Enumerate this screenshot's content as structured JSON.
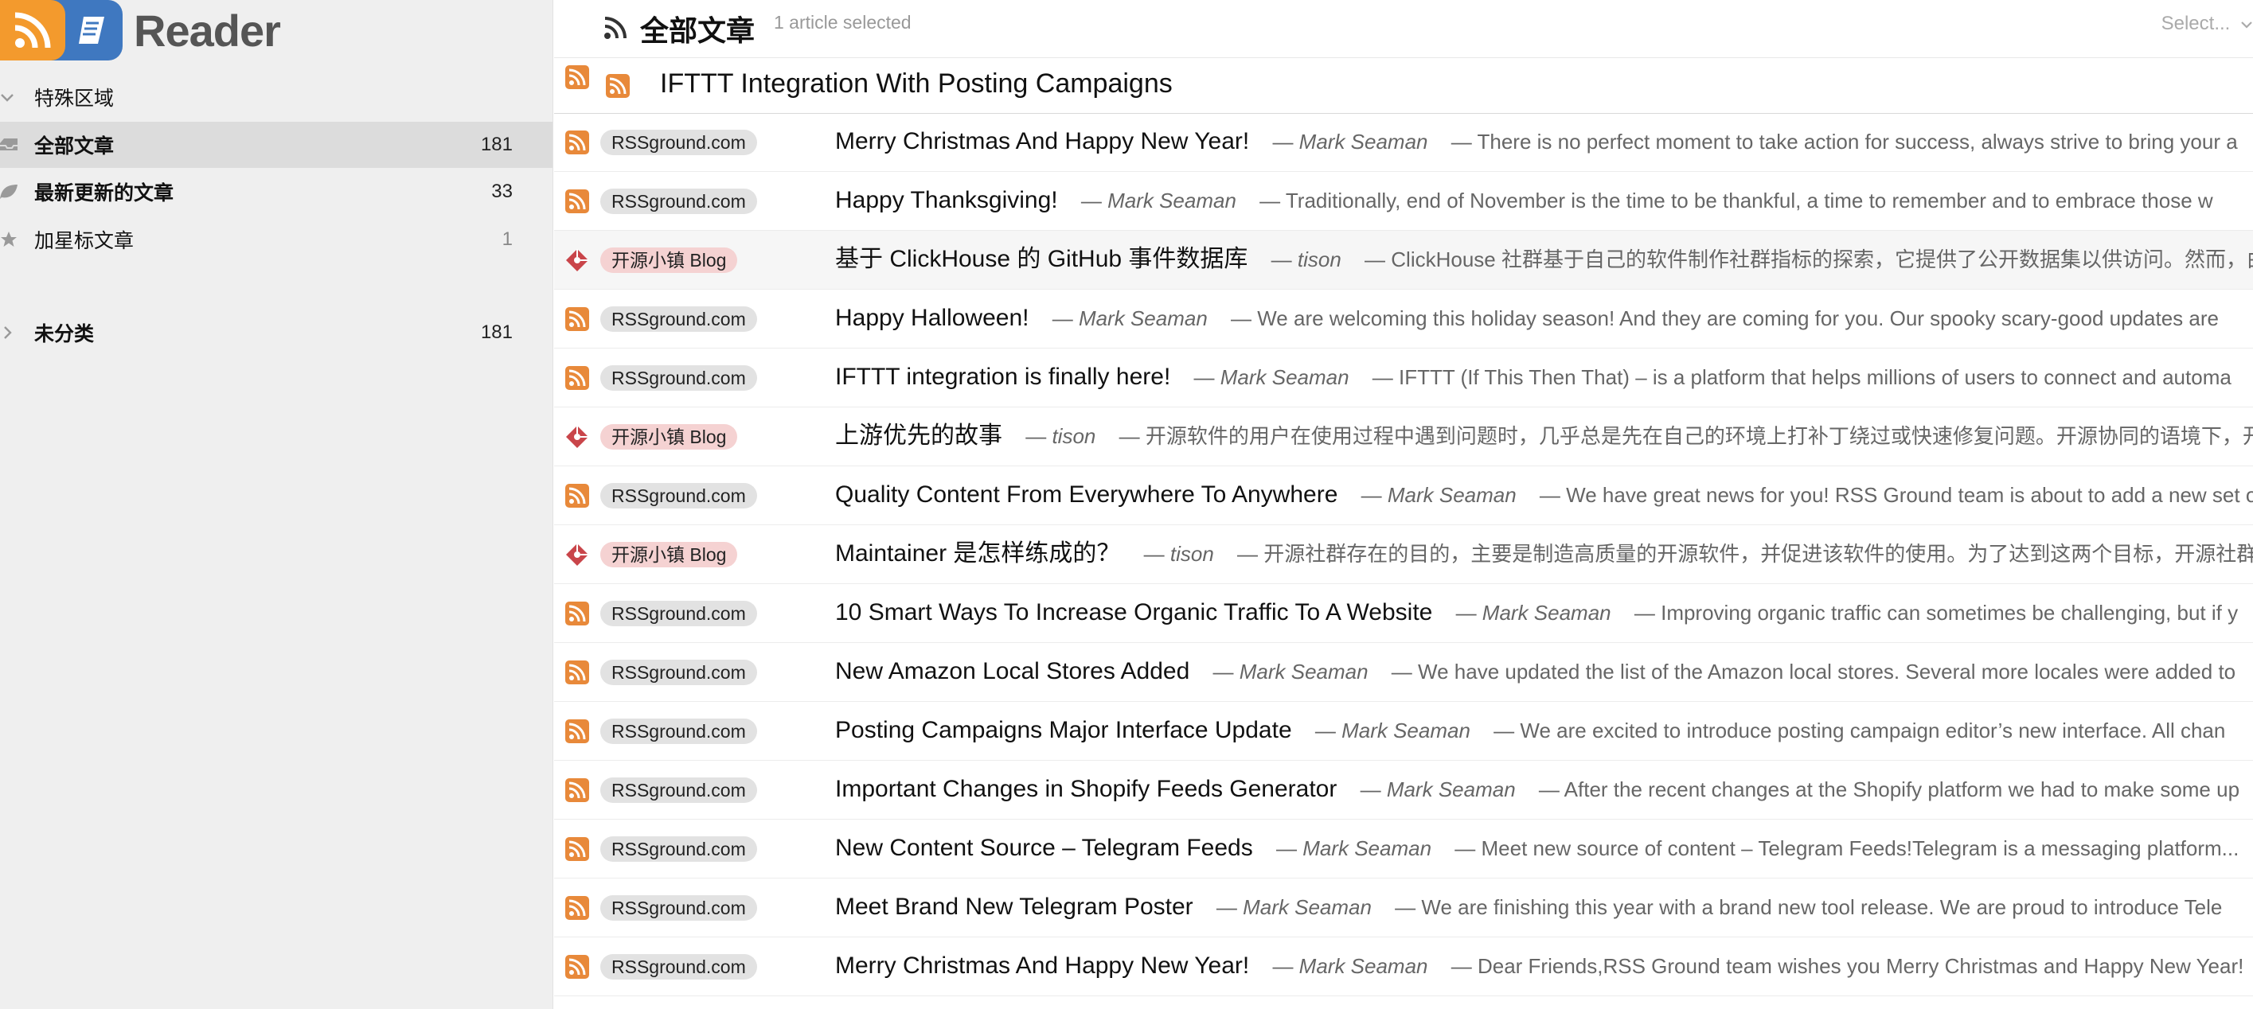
{
  "logo": {
    "text": "Reader"
  },
  "sidebar": {
    "items": [
      {
        "label": "特殊区域",
        "count": "",
        "icon": "chevron-down-icon"
      },
      {
        "label": "全部文章",
        "count": "181",
        "icon": "inbox-icon"
      },
      {
        "label": "最新更新的文章",
        "count": "33",
        "icon": "leaf-icon"
      },
      {
        "label": "加星标文章",
        "count": "1",
        "icon": "star-icon"
      },
      {
        "label": "未分类",
        "count": "181",
        "icon": "chevron-right-icon"
      }
    ]
  },
  "header": {
    "title": "全部文章",
    "selected_text": "1 article selected",
    "select_label": "Select..."
  },
  "selected_article": {
    "title": "IFTTT Integration With Posting Campaigns"
  },
  "separator": "—",
  "articles": [
    {
      "feed": "RSSground.com",
      "title": "Merry Christmas And Happy New Year!",
      "author": "Mark Seaman",
      "snippet": "There is no perfect moment to take action for success, always strive to bring your a"
    },
    {
      "feed": "RSSground.com",
      "title": "Happy Thanksgiving!",
      "author": "Mark Seaman",
      "snippet": "Traditionally, end of November is the time to be thankful, a time to remember and to embrace those w"
    },
    {
      "feed": "开源小镇 Blog",
      "title": "基于 ClickHouse 的 GitHub 事件数据库",
      "author": "tison",
      "snippet": "ClickHouse 社群基于自己的软件制作社群指标的探索，它提供了公开数据集以供访问。然而，由"
    },
    {
      "feed": "RSSground.com",
      "title": "Happy Halloween!",
      "author": "Mark Seaman",
      "snippet": "We are welcoming this holiday season! And they are coming for you. Our spooky scary-good updates are"
    },
    {
      "feed": "RSSground.com",
      "title": "IFTTT integration is finally here!",
      "author": "Mark Seaman",
      "snippet": "IFTTT (If This Then That) – is a platform that helps millions of users to connect and automa"
    },
    {
      "feed": "开源小镇 Blog",
      "title": "上游优先的故事",
      "author": "tison",
      "snippet": "开源软件的用户在使用过程中遇到问题时，几乎总是先在自己的环境上打补丁绕过或快速修复问题。开源协同的语境下，开"
    },
    {
      "feed": "RSSground.com",
      "title": "Quality Content From Everywhere To Anywhere",
      "author": "Mark Seaman",
      "snippet": "We have great news for you! RSS Ground team is about to add a new set o"
    },
    {
      "feed": "开源小镇 Blog",
      "title": "Maintainer 是怎样练成的？",
      "author": "tison",
      "snippet": "开源社群存在的目的，主要是制造高质量的开源软件，并促进该软件的使用。为了达到这两个目标，开源社群"
    },
    {
      "feed": "RSSground.com",
      "title": "10 Smart Ways To Increase Organic Traffic To A Website",
      "author": "Mark Seaman",
      "snippet": "Improving organic traffic can sometimes be challenging, but if y"
    },
    {
      "feed": "RSSground.com",
      "title": "New Amazon Local Stores Added",
      "author": "Mark Seaman",
      "snippet": "We have updated the list of the Amazon local stores. Several more locales were added to"
    },
    {
      "feed": "RSSground.com",
      "title": "Posting Campaigns Major Interface Update",
      "author": "Mark Seaman",
      "snippet": "We are excited to introduce posting campaign editor’s new interface. All chan"
    },
    {
      "feed": "RSSground.com",
      "title": "Important Changes in Shopify Feeds Generator",
      "author": "Mark Seaman",
      "snippet": "After the recent changes at the Shopify platform we had to make some up"
    },
    {
      "feed": "RSSground.com",
      "title": "New Content Source – Telegram Feeds",
      "author": "Mark Seaman",
      "snippet": "Meet new source of content – Telegram Feeds!Telegram is a messaging platform..."
    },
    {
      "feed": "RSSground.com",
      "title": "Meet Brand New Telegram Poster",
      "author": "Mark Seaman",
      "snippet": "We are finishing this year with a brand new tool release. We are proud to introduce Tele"
    },
    {
      "feed": "RSSground.com",
      "title": "Merry Christmas And Happy New Year!",
      "author": "Mark Seaman",
      "snippet": "Dear Friends,RSS Ground team wishes you Merry Christmas and Happy New Year!"
    }
  ],
  "colors": {
    "rss_orange": "#e8893a",
    "logo_orange": "#f39a2d",
    "logo_blue": "#3f78c0",
    "blog_red": "#c9454a",
    "sidebar_bg": "#efefef",
    "active_bg": "#dcdcdc",
    "pink_badge": "#f5d2d2"
  }
}
